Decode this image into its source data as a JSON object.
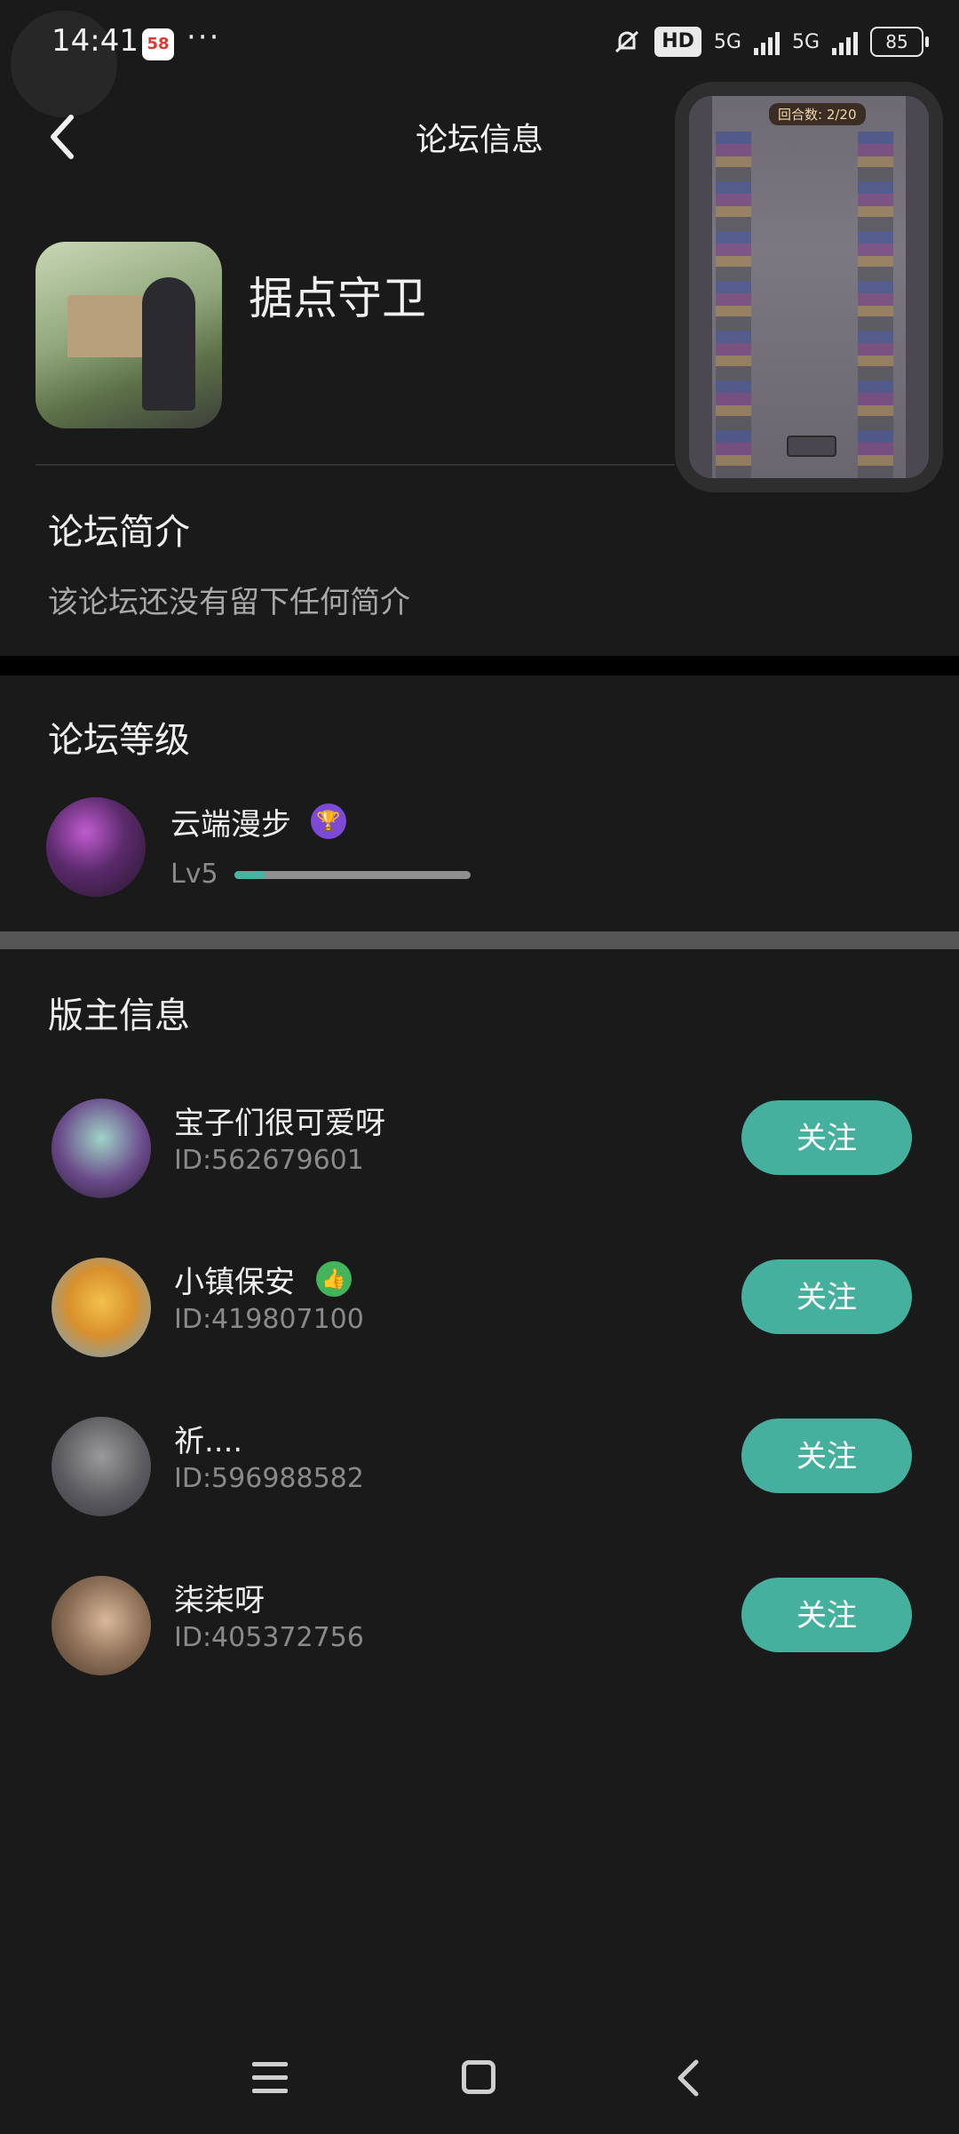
{
  "status_bar": {
    "time": "14:41",
    "app_badge": "58",
    "more": "···",
    "hd": "HD",
    "net1": "5G",
    "net2": "5G",
    "battery": "85"
  },
  "header": {
    "title": "论坛信息"
  },
  "game_overlay": {
    "rounds": "回合数: 2/20"
  },
  "forum": {
    "name": "据点守卫"
  },
  "intro": {
    "title": "论坛简介",
    "text": "该论坛还没有留下任何简介"
  },
  "level": {
    "title": "论坛等级",
    "user": "云端漫步",
    "lv": "Lv5",
    "progress": 0.13
  },
  "moderators": {
    "title": "版主信息",
    "items": [
      {
        "name": "宝子们很可爱呀",
        "id": "ID:562679601",
        "follow": "关注"
      },
      {
        "name": "小镇保安",
        "id": "ID:419807100",
        "follow": "关注"
      },
      {
        "name": "祈....",
        "id": "ID:596988582",
        "follow": "关注"
      },
      {
        "name": "柒柒呀",
        "id": "ID:405372756",
        "follow": "关注"
      }
    ]
  },
  "colors": {
    "accent": "#46b09f",
    "background": "#1a1a1b",
    "trophy_badge": "#7c4ad6",
    "thumb_badge": "#43b35c"
  }
}
